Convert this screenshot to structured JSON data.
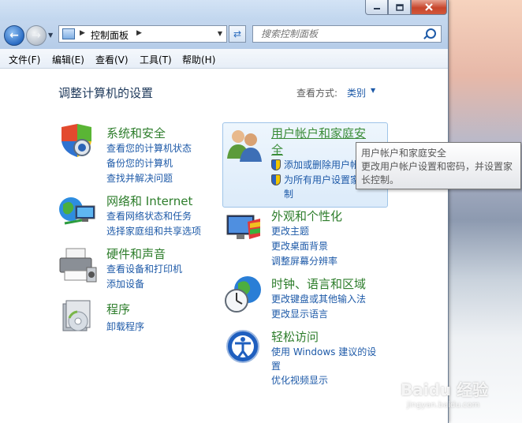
{
  "nav": {
    "address_crumb": "控制面板",
    "search_placeholder": "搜索控制面板"
  },
  "menu": [
    "文件(F)",
    "编辑(E)",
    "查看(V)",
    "工具(T)",
    "帮助(H)"
  ],
  "main": {
    "title": "调整计算机的设置",
    "view_by_label": "查看方式:",
    "view_by_value": "类别"
  },
  "categories": {
    "system_security": {
      "title": "系统和安全",
      "links": [
        "查看您的计算机状态",
        "备份您的计算机",
        "查找并解决问题"
      ]
    },
    "network": {
      "title": "网络和 Internet",
      "links": [
        "查看网络状态和任务",
        "选择家庭组和共享选项"
      ]
    },
    "hardware": {
      "title": "硬件和声音",
      "links": [
        "查看设备和打印机",
        "添加设备"
      ]
    },
    "programs": {
      "title": "程序",
      "links": [
        "卸载程序"
      ]
    },
    "user_accounts": {
      "title_line1": "用户帐户和家庭安",
      "title_line2": "全",
      "links": [
        "添加或删除用户帐",
        "为所有用户设置家",
        "制"
      ]
    },
    "appearance": {
      "title": "外观和个性化",
      "links": [
        "更改主题",
        "更改桌面背景",
        "调整屏幕分辨率"
      ]
    },
    "clock": {
      "title": "时钟、语言和区域",
      "links": [
        "更改键盘或其他输入法",
        "更改显示语言"
      ]
    },
    "ease": {
      "title": "轻松访问",
      "links": [
        "使用 Windows 建议的设",
        "置",
        "优化视频显示"
      ]
    }
  },
  "tooltip": {
    "line1": "用户帐户和家庭安全",
    "line2": "更改用户帐户设置和密码，并设置家",
    "line3": "长控制。"
  },
  "watermark": {
    "text": "Baidu 经验",
    "url": "jingyan.baidu.com"
  }
}
